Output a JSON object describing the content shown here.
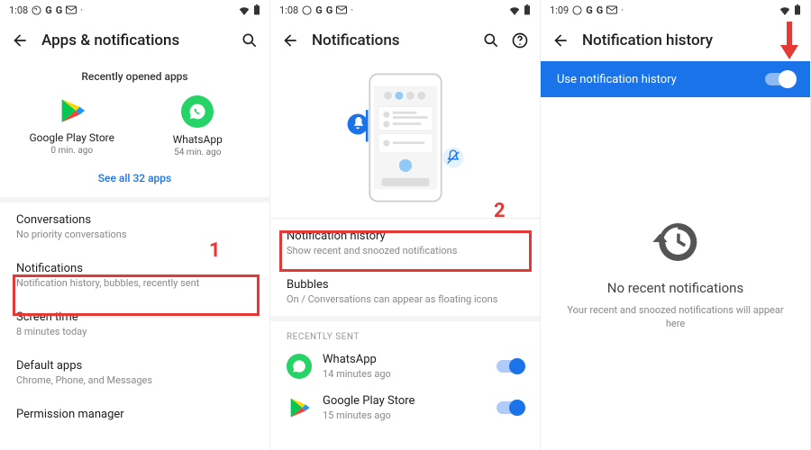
{
  "panel1": {
    "status": {
      "time": "1:08"
    },
    "header": {
      "title": "Apps & notifications"
    },
    "recent_label": "Recently opened apps",
    "apps": [
      {
        "name": "Google Play Store",
        "sub": "0 min. ago"
      },
      {
        "name": "WhatsApp",
        "sub": "54 min. ago"
      }
    ],
    "see_all": "See all 32 apps",
    "items": [
      {
        "title": "Conversations",
        "sub": "No priority conversations"
      },
      {
        "title": "Notifications",
        "sub": "Notification history, bubbles, recently sent"
      },
      {
        "title": "Screen time",
        "sub": "8 minutes today"
      },
      {
        "title": "Default apps",
        "sub": "Chrome, Phone, and Messages"
      },
      {
        "title": "Permission manager",
        "sub": ""
      }
    ],
    "highlight_num": "1"
  },
  "panel2": {
    "status": {
      "time": "1:08"
    },
    "header": {
      "title": "Notifications"
    },
    "items": [
      {
        "title": "Notification history",
        "sub": "Show recent and snoozed notifications"
      },
      {
        "title": "Bubbles",
        "sub": "On / Conversations can appear as floating icons"
      }
    ],
    "section_label": "RECENTLY SENT",
    "sent": [
      {
        "name": "WhatsApp",
        "sub": "14 minutes ago"
      },
      {
        "name": "Google Play Store",
        "sub": "15 minutes ago"
      }
    ],
    "highlight_num": "2"
  },
  "panel3": {
    "status": {
      "time": "1:09"
    },
    "header": {
      "title": "Notification history"
    },
    "toggle_label": "Use notification history",
    "empty": {
      "title": "No recent notifications",
      "sub": "Your recent and snoozed notifications will appear here"
    }
  }
}
